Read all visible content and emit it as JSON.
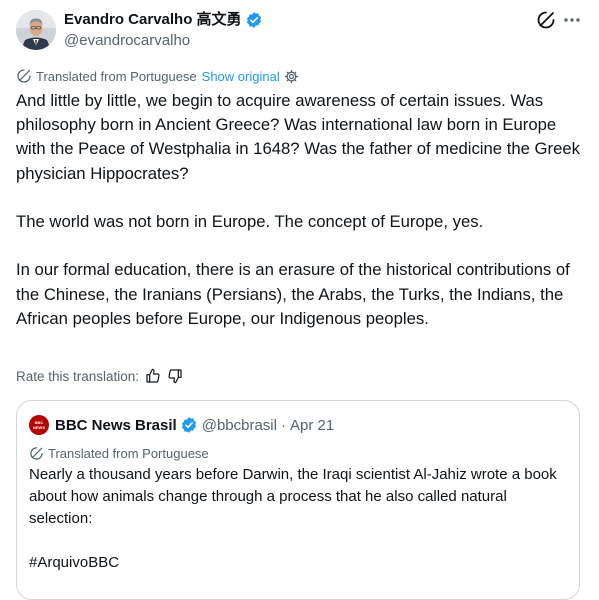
{
  "tweet": {
    "author": {
      "name": "Evandro Carvalho 高文勇",
      "handle": "@evandrocarvalho"
    },
    "translation_notice": "Translated from Portuguese",
    "show_original_label": "Show original",
    "text": "And little by little, we begin to acquire awareness of certain issues. Was philosophy born in Ancient Greece? Was international law born in Europe with the Peace of Westphalia in 1648? Was the father of medicine the Greek physician Hippocrates?\n\nThe world was not born in Europe. The concept of Europe, yes.\n\nIn our formal education, there is an erasure of the historical contributions of the Chinese, the Iranians (Persians), the Arabs, the Turks, the Indians, the African peoples before Europe, our Indigenous peoples.",
    "rate_label": "Rate this translation:"
  },
  "quote": {
    "logo_text": "BBC NEWS",
    "author": {
      "name": "BBC News Brasil",
      "handle": "@bbcbrasil",
      "separator": "·",
      "date": "Apr 21"
    },
    "translation_notice": "Translated from Portuguese",
    "text": "Nearly a thousand years before Darwin, the Iraqi scientist Al-Jahiz wrote a book about how animals change through a process that he also called natural selection:\n\n#ArquivoBBC"
  },
  "colors": {
    "accent": "#1d9bf0",
    "secondary_text": "#536471",
    "border": "#cfd9de",
    "bbc_red": "#b80000"
  }
}
